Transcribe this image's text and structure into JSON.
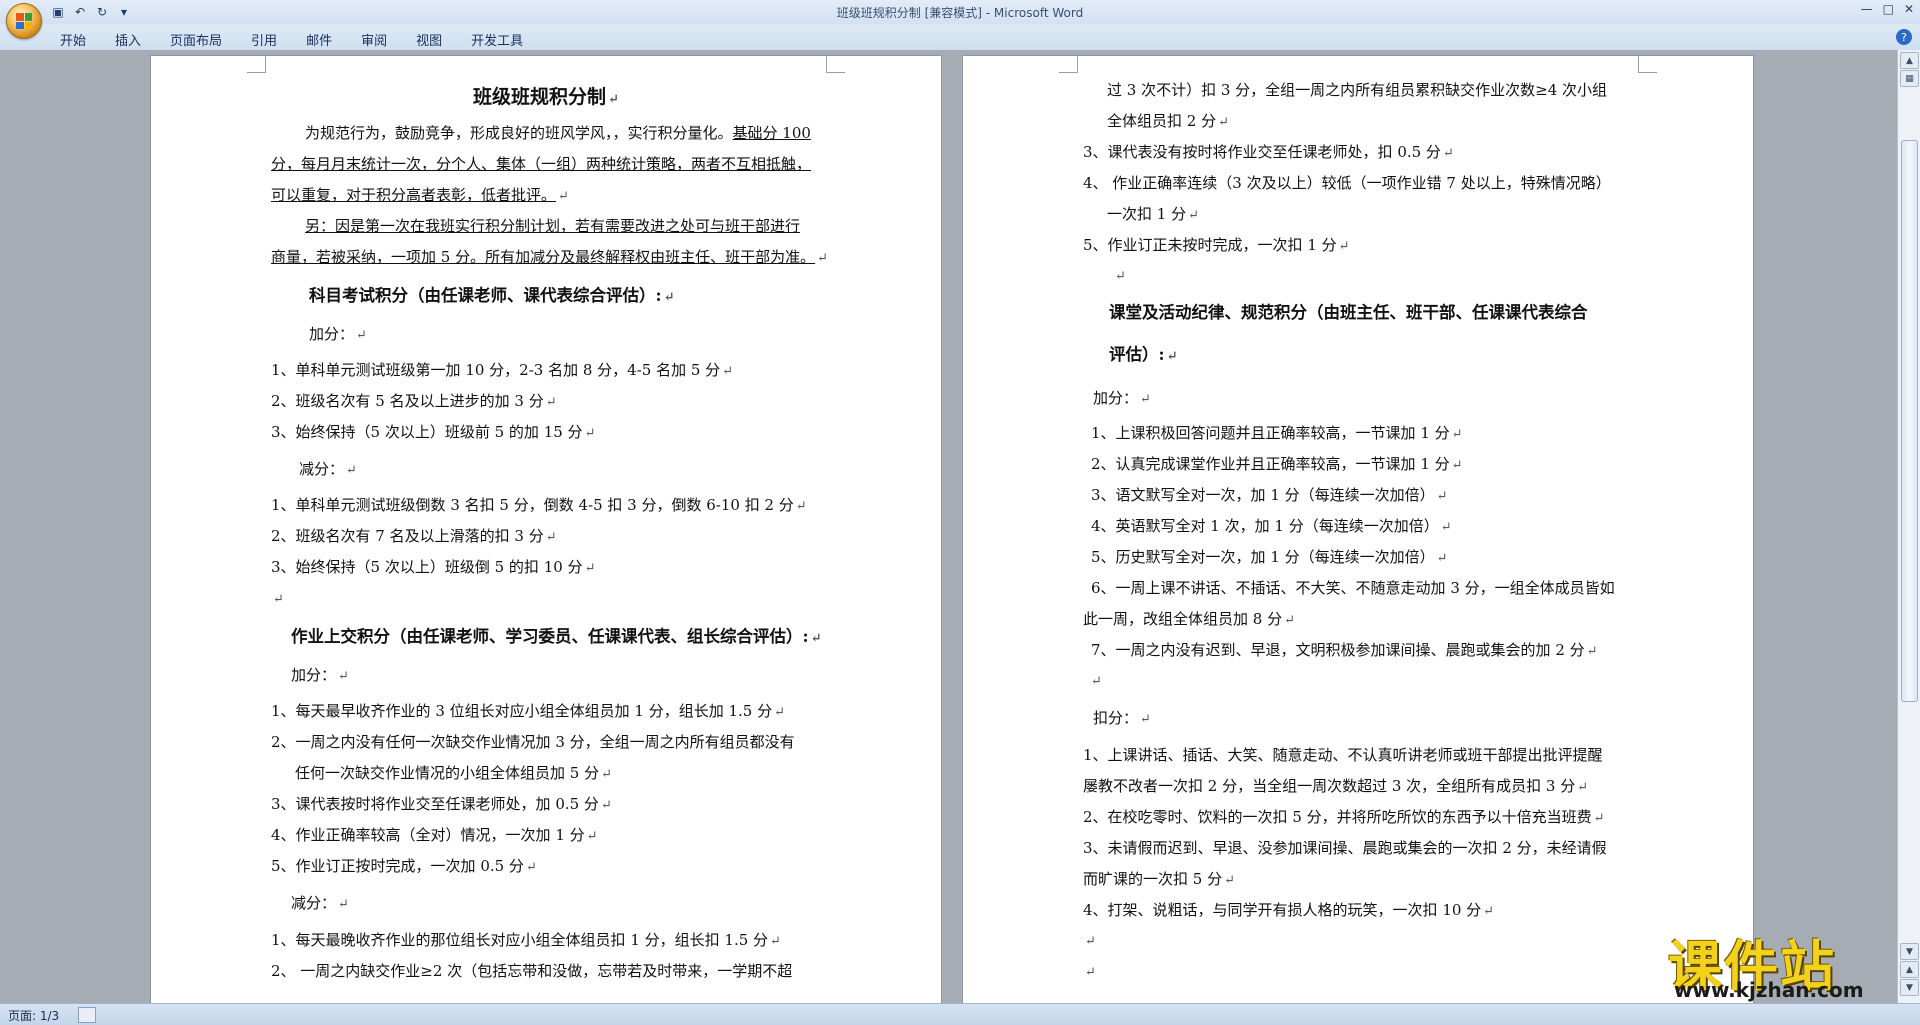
{
  "window": {
    "title": "班级班规积分制 [兼容模式] - Microsoft Word",
    "tabs": [
      "开始",
      "插入",
      "页面布局",
      "引用",
      "邮件",
      "审阅",
      "视图",
      "开发工具"
    ],
    "icons": [
      "office-button",
      "save-icon",
      "undo-icon",
      "redo-icon",
      "customize-icon",
      "minimize-icon",
      "maximize-icon",
      "close-icon",
      "help-icon"
    ]
  },
  "status": {
    "page": "页面: 1/3"
  },
  "watermark": {
    "main": "课件站",
    "sub": "www.kjzhan.com"
  },
  "page1": {
    "title": "班级班规积分制",
    "intro1a": "为规范行为，鼓励竞争，形成良好的班风学风，，实行积分量化。",
    "intro1b": "基础分 100",
    "intro2": "分，每月月末统计一次，分个人、集体（一组）两种统计策略，两者不互相抵触，",
    "intro3": "可以重复，对于积分高者表彰，低者批评。",
    "note1": "另：因是第一次在我班实行积分制计划，若有需要改进之处可与班干部进行",
    "note2": "商量，若被采纳，一项加 5 分。所有加减分及最终解释权由班主任、班干部为准。",
    "sec1": "科目考试积分（由任课老师、课代表综合评估）:",
    "add1": "加分：",
    "s1a1": "1、单科单元测试班级第一加 10 分，2-3 名加 8 分，4-5 名加 5 分",
    "s1a2": "2、班级名次有 5 名及以上进步的加 3 分",
    "s1a3": "3、始终保持（5 次以上）班级前 5 的加 15 分",
    "sub1": "减分：",
    "s1d1": "1、单科单元测试班级倒数 3 名扣 5 分，倒数 4-5 扣 3 分，倒数 6-10 扣 2 分",
    "s1d2": "2、班级名次有 7 名及以上滑落的扣 3 分",
    "s1d3": "3、始终保持（5 次以上）班级倒 5 的扣 10 分",
    "sec2": "作业上交积分（由任课老师、学习委员、任课课代表、组长综合评估）:",
    "add2": "加分：",
    "s2a1": "1、每天最早收齐作业的 3 位组长对应小组全体组员加 1 分，组长加 1.5 分",
    "s2a2a": "2、一周之内没有任何一次缺交作业情况加 3 分，全组一周之内所有组员都没有",
    "s2a2b": "任何一次缺交作业情况的小组全体组员加 5 分",
    "s2a3": "3、课代表按时将作业交至任课老师处，加 0.5 分",
    "s2a4": "4、作业正确率较高（全对）情况，一次加 1 分",
    "s2a5": "5、作业订正按时完成，一次加 0.5 分",
    "sub2": "减分：",
    "s2d1": "1、每天最晚收齐作业的那位组长对应小组全体组员扣 1 分，组长扣 1.5 分",
    "s2d2": "2、  一周之内缺交作业≥2 次（包括忘带和没做，忘带若及时带来，一学期不超"
  },
  "page2": {
    "c1a": "过 3 次不计）扣 3 分，全组一周之内所有组员累积缺交作业次数≥4 次小组",
    "c1b": "全体组员扣 2 分",
    "c3": "3、课代表没有按时将作业交至任课老师处，扣 0.5 分",
    "c4a": "4、  作业正确率连续（3 次及以上）较低（一项作业错 7 处以上，特殊情况略）",
    "c4b": "一次扣 1 分",
    "c5": "5、作业订正未按时完成，一次扣 1 分",
    "sec3a": "课堂及活动纪律、规范积分（由班主任、班干部、任课课代表综合",
    "sec3b": "评估）:",
    "add3": "加分：",
    "r1": "1、上课积极回答问题并且正确率较高，一节课加 1 分",
    "r2": "2、认真完成课堂作业并且正确率较高，一节课加 1 分",
    "r3": "3、语文默写全对一次，加 1 分（每连续一次加倍）",
    "r4": "4、英语默写全对 1 次，加 1 分（每连续一次加倍）",
    "r5": "5、历史默写全对一次，加 1 分（每连续一次加倍）",
    "r6a": "6、一周上课不讲话、不插话、不大笑、不随意走动加 3 分，一组全体成员皆如",
    "r6b": "此一周，改组全体组员加 8 分",
    "r7": "7、一周之内没有迟到、早退，文明积极参加课间操、晨跑或集会的加 2 分",
    "ded3": "扣分：",
    "k1a": "1、上课讲话、插话、大笑、随意走动、不认真听讲老师或班干部提出批评提醒",
    "k1b": "屡教不改者一次扣 2 分，当全组一周次数超过 3 次，全组所有成员扣 3 分",
    "k2": "2、在校吃零时、饮料的一次扣 5 分，并将所吃所饮的东西予以十倍充当班费",
    "k3a": "3、未请假而迟到、早退、没参加课间操、晨跑或集会的一次扣 2 分，未经请假",
    "k3b": "而旷课的一次扣 5 分",
    "k4": "4、打架、说粗话，与同学开有损人格的玩笑，一次扣 10 分"
  }
}
